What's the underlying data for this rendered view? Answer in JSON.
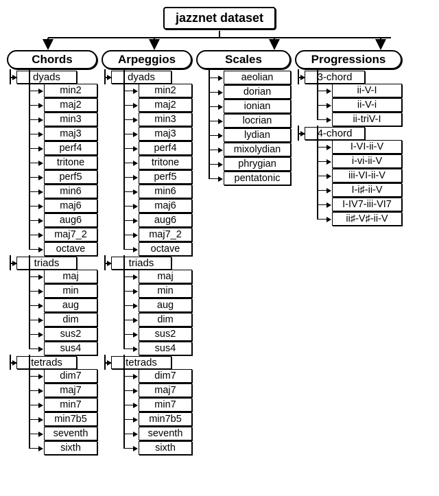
{
  "root": {
    "title": "jazznet dataset"
  },
  "columns": [
    {
      "title": "Chords",
      "groups": [
        {
          "title": "dyads",
          "items": [
            "min2",
            "maj2",
            "min3",
            "maj3",
            "perf4",
            "tritone",
            "perf5",
            "min6",
            "maj6",
            "aug6",
            "maj7_2",
            "octave"
          ]
        },
        {
          "title": "triads",
          "items": [
            "maj",
            "min",
            "aug",
            "dim",
            "sus2",
            "sus4"
          ]
        },
        {
          "title": "tetrads",
          "items": [
            "dim7",
            "maj7",
            "min7",
            "min7b5",
            "seventh",
            "sixth"
          ]
        }
      ]
    },
    {
      "title": "Arpeggios",
      "groups": [
        {
          "title": "dyads",
          "items": [
            "min2",
            "maj2",
            "min3",
            "maj3",
            "perf4",
            "tritone",
            "perf5",
            "min6",
            "maj6",
            "aug6",
            "maj7_2",
            "octave"
          ]
        },
        {
          "title": "triads",
          "items": [
            "maj",
            "min",
            "aug",
            "dim",
            "sus2",
            "sus4"
          ]
        },
        {
          "title": "tetrads",
          "items": [
            "dim7",
            "maj7",
            "min7",
            "min7b5",
            "seventh",
            "sixth"
          ]
        }
      ]
    },
    {
      "title": "Scales",
      "groups": [
        {
          "title": null,
          "items": [
            "aeolian",
            "dorian",
            "ionian",
            "locrian",
            "lydian",
            "mixolydian",
            "phrygian",
            "pentatonic"
          ]
        }
      ]
    },
    {
      "title": "Progressions",
      "groups": [
        {
          "title": "3-chord",
          "items": [
            "ii-V-I",
            "ii-V-i",
            "ii-triV-I"
          ]
        },
        {
          "title": "4-chord",
          "items": [
            "I-VI-ii-V",
            "i-vi-ii-V",
            "iii-VI-ii-V",
            "I-i♯-ii-V",
            "I-IV7-iii-VI7",
            "ii♯-V♯-ii-V"
          ]
        }
      ]
    }
  ]
}
